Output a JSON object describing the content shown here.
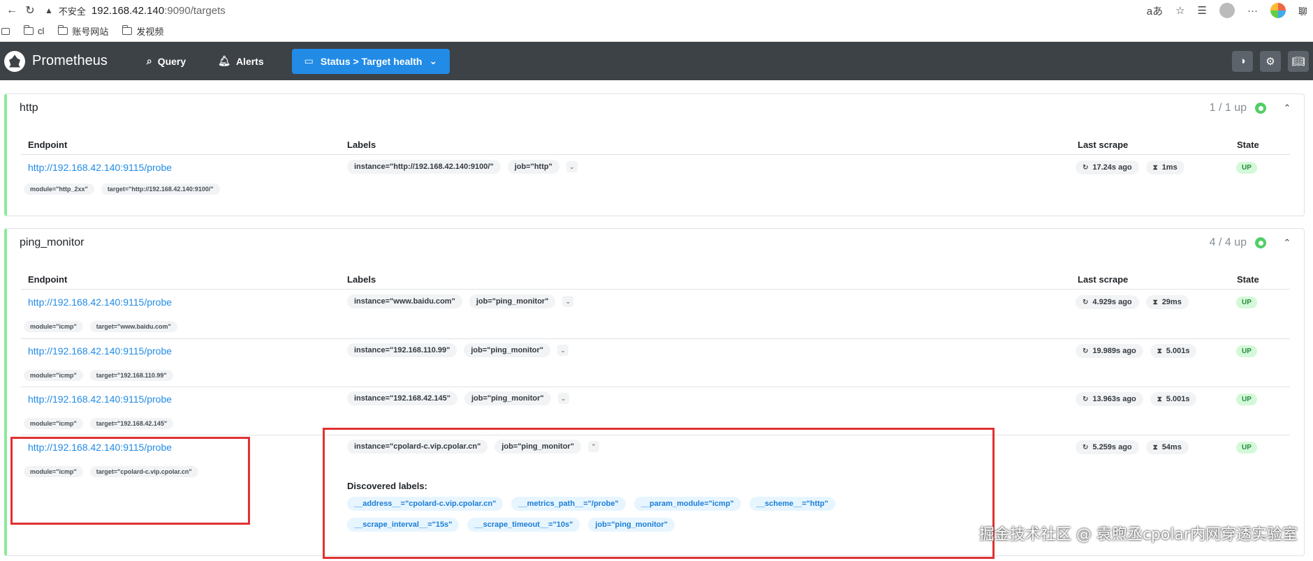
{
  "browser": {
    "insecure_label": "不安全",
    "url_host": "192.168.42.140",
    "url_path": ":9090/targets",
    "cut_text": "聊"
  },
  "bookmarks": [
    {
      "label": "cl"
    },
    {
      "label": "账号网站"
    },
    {
      "label": "发视频"
    }
  ],
  "header": {
    "title": "Prometheus",
    "nav_query": "Query",
    "nav_alerts": "Alerts",
    "status_label": "Status > Target health"
  },
  "table_headers": {
    "endpoint": "Endpoint",
    "labels": "Labels",
    "last_scrape": "Last scrape",
    "state": "State"
  },
  "pools": [
    {
      "name": "http",
      "up": "1 / 1 up",
      "targets": [
        {
          "endpoint": "http://192.168.42.140:9115/probe",
          "sub_labels": [
            "module=\"http_2xx\"",
            "target=\"http://192.168.42.140:9100/\""
          ],
          "labels": [
            "instance=\"http://192.168.42.140:9100/\"",
            "job=\"http\""
          ],
          "last_scrape": "17.24s ago",
          "duration": "1ms",
          "state": "UP"
        }
      ]
    },
    {
      "name": "ping_monitor",
      "up": "4 / 4 up",
      "targets": [
        {
          "endpoint": "http://192.168.42.140:9115/probe",
          "sub_labels": [
            "module=\"icmp\"",
            "target=\"www.baidu.com\""
          ],
          "labels": [
            "instance=\"www.baidu.com\"",
            "job=\"ping_monitor\""
          ],
          "last_scrape": "4.929s ago",
          "duration": "29ms",
          "state": "UP"
        },
        {
          "endpoint": "http://192.168.42.140:9115/probe",
          "sub_labels": [
            "module=\"icmp\"",
            "target=\"192.168.110.99\""
          ],
          "labels": [
            "instance=\"192.168.110.99\"",
            "job=\"ping_monitor\""
          ],
          "last_scrape": "19.989s ago",
          "duration": "5.001s",
          "state": "UP"
        },
        {
          "endpoint": "http://192.168.42.140:9115/probe",
          "sub_labels": [
            "module=\"icmp\"",
            "target=\"192.168.42.145\""
          ],
          "labels": [
            "instance=\"192.168.42.145\"",
            "job=\"ping_monitor\""
          ],
          "last_scrape": "13.963s ago",
          "duration": "5.001s",
          "state": "UP"
        },
        {
          "endpoint": "http://192.168.42.140:9115/probe",
          "sub_labels": [
            "module=\"icmp\"",
            "target=\"cpolard-c.vip.cpolar.cn\""
          ],
          "labels": [
            "instance=\"cpolard-c.vip.cpolar.cn\"",
            "job=\"ping_monitor\""
          ],
          "last_scrape": "5.259s ago",
          "duration": "54ms",
          "state": "UP",
          "discovered_title": "Discovered labels:",
          "discovered": [
            "__address__=\"cpolard-c.vip.cpolar.cn\"",
            "__metrics_path__=\"/probe\"",
            "__param_module=\"icmp\"",
            "__scheme__=\"http\"",
            "__scrape_interval__=\"15s\"",
            "__scrape_timeout__=\"10s\"",
            "job=\"ping_monitor\""
          ]
        }
      ]
    }
  ],
  "watermark": "掘金技术社区 @ 袁煦丞cpolar内网穿透实验室"
}
